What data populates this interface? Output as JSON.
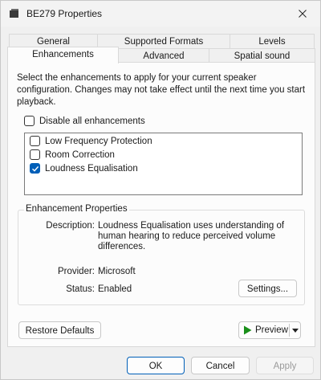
{
  "window": {
    "title": "BE279 Properties"
  },
  "icons": {
    "app": "speaker-icon",
    "close": "close-icon",
    "play": "play-icon",
    "dropdown": "chevron-down-icon",
    "check": "check-icon"
  },
  "colors": {
    "accent": "#005fb8",
    "play_green": "#1a8f1a"
  },
  "tabs": {
    "row1": [
      "General",
      "Supported Formats",
      "Levels"
    ],
    "row2": [
      "Enhancements",
      "Advanced",
      "Spatial sound"
    ],
    "active": "Enhancements"
  },
  "enhancements": {
    "description": "Select the enhancements to apply for your current speaker configuration. Changes may not take effect until the next time you start playback.",
    "disable_all": {
      "label": "Disable all enhancements",
      "checked": false
    },
    "items": [
      {
        "label": "Low Frequency Protection",
        "checked": false
      },
      {
        "label": "Room Correction",
        "checked": false
      },
      {
        "label": "Loudness Equalisation",
        "checked": true
      }
    ]
  },
  "properties": {
    "title": "Enhancement Properties",
    "description_label": "Description:",
    "description_value": "Loudness Equalisation uses understanding of human hearing to reduce perceived volume differences.",
    "provider_label": "Provider:",
    "provider_value": "Microsoft",
    "status_label": "Status:",
    "status_value": "Enabled",
    "settings_button": "Settings..."
  },
  "buttons": {
    "restore_defaults": "Restore Defaults",
    "preview": "Preview",
    "ok": "OK",
    "cancel": "Cancel",
    "apply": "Apply"
  }
}
